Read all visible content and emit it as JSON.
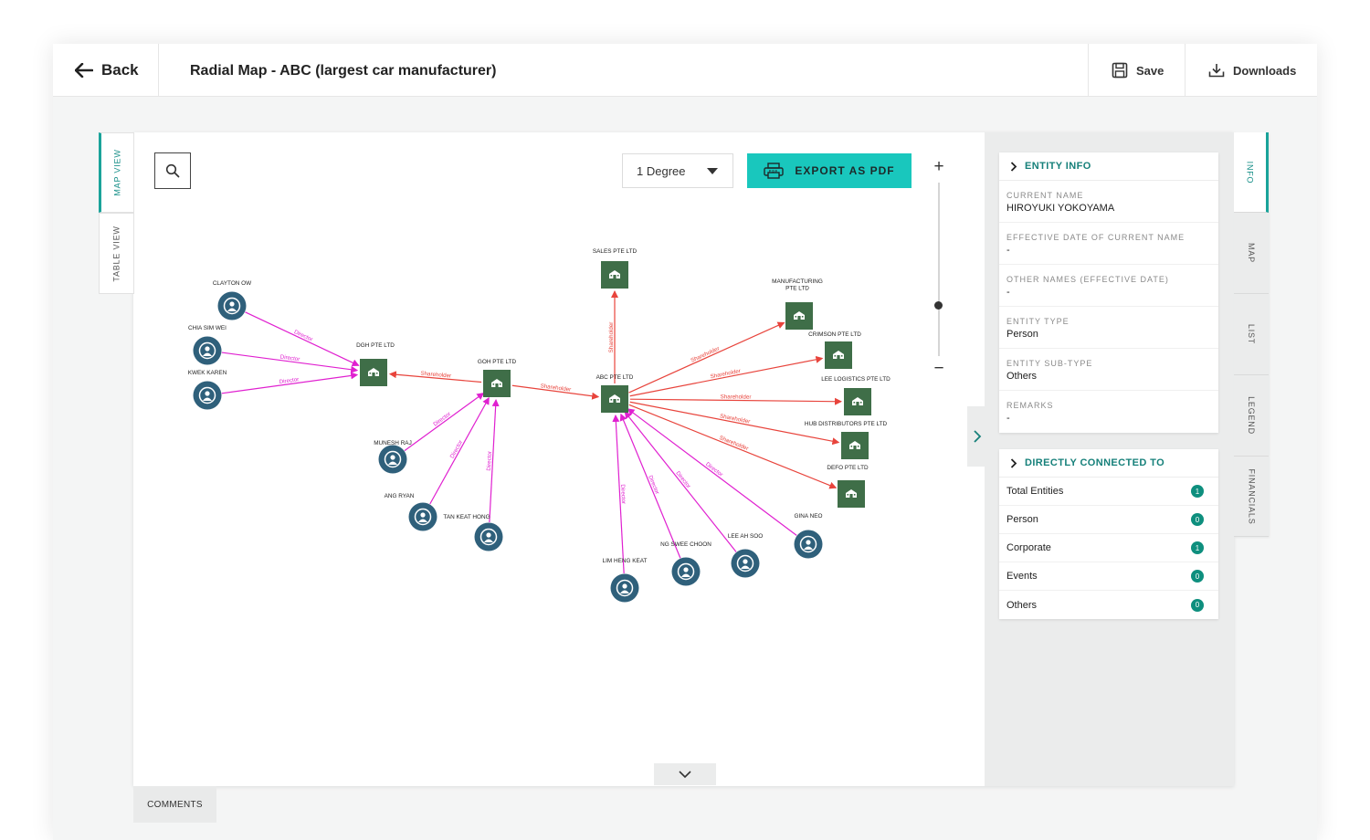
{
  "header": {
    "back_label": "Back",
    "title": "Radial Map - ABC (largest car manufacturer)",
    "save_label": "Save",
    "downloads_label": "Downloads"
  },
  "left_tabs": [
    {
      "label": "MAP VIEW",
      "active": true
    },
    {
      "label": "TABLE VIEW",
      "active": false
    }
  ],
  "toolbar": {
    "degree_selected": "1 Degree",
    "export_label": "EXPORT AS PDF"
  },
  "graph": {
    "nodes": [
      {
        "id": "clayton",
        "label": "CLAYTON OW",
        "type": "person"
      },
      {
        "id": "chia",
        "label": "CHIA SIM WEI",
        "type": "person"
      },
      {
        "id": "kwek",
        "label": "KWEK KAREN",
        "type": "person"
      },
      {
        "id": "dgh",
        "label": "DGH PTE LTD",
        "type": "company"
      },
      {
        "id": "goh",
        "label": "GOH PTE LTD",
        "type": "company"
      },
      {
        "id": "munesh",
        "label": "MUNESH RAJ",
        "type": "person"
      },
      {
        "id": "ang",
        "label": "ANG RYAN",
        "type": "person"
      },
      {
        "id": "tan",
        "label": "TAN KEAT HONG",
        "type": "person"
      },
      {
        "id": "abc",
        "label": "ABC PTE LTD",
        "type": "company"
      },
      {
        "id": "sales",
        "label": "SALES PTE LTD",
        "type": "company"
      },
      {
        "id": "manu",
        "label": "MANUFACTURING PTE LTD",
        "type": "company"
      },
      {
        "id": "crimson",
        "label": "CRIMSON PTE LTD",
        "type": "company"
      },
      {
        "id": "leelog",
        "label": "LEE LOGISTICS PTE LTD",
        "type": "company"
      },
      {
        "id": "hub",
        "label": "HUB DISTRIBUTORS PTE LTD",
        "type": "company"
      },
      {
        "id": "defo",
        "label": "DEFO PTE LTD",
        "type": "company"
      },
      {
        "id": "gina",
        "label": "GINA NEO",
        "type": "person"
      },
      {
        "id": "leeah",
        "label": "LEE AH SOO",
        "type": "person"
      },
      {
        "id": "ngswee",
        "label": "NG SWEE CHOON",
        "type": "person"
      },
      {
        "id": "limheng",
        "label": "LIM HENG KEAT",
        "type": "person"
      }
    ],
    "edges": [
      {
        "from": "clayton",
        "to": "dgh",
        "label": "Director",
        "kind": "director"
      },
      {
        "from": "chia",
        "to": "dgh",
        "label": "Director",
        "kind": "director"
      },
      {
        "from": "kwek",
        "to": "dgh",
        "label": "Director",
        "kind": "director"
      },
      {
        "from": "goh",
        "to": "dgh",
        "label": "Shareholder",
        "kind": "shareholder"
      },
      {
        "from": "munesh",
        "to": "goh",
        "label": "Director",
        "kind": "director"
      },
      {
        "from": "ang",
        "to": "goh",
        "label": "Director",
        "kind": "director"
      },
      {
        "from": "tan",
        "to": "goh",
        "label": "Director",
        "kind": "director"
      },
      {
        "from": "goh",
        "to": "abc",
        "label": "Shareholder",
        "kind": "shareholder"
      },
      {
        "from": "abc",
        "to": "sales",
        "label": "Shareholder",
        "kind": "shareholder"
      },
      {
        "from": "abc",
        "to": "manu",
        "label": "Shareholder",
        "kind": "shareholder"
      },
      {
        "from": "abc",
        "to": "crimson",
        "label": "Shareholder",
        "kind": "shareholder"
      },
      {
        "from": "abc",
        "to": "leelog",
        "label": "Shareholder",
        "kind": "shareholder"
      },
      {
        "from": "abc",
        "to": "hub",
        "label": "Shareholder",
        "kind": "shareholder"
      },
      {
        "from": "abc",
        "to": "defo",
        "label": "Shareholder",
        "kind": "shareholder"
      },
      {
        "from": "gina",
        "to": "abc",
        "label": "Director",
        "kind": "director"
      },
      {
        "from": "leeah",
        "to": "abc",
        "label": "Director",
        "kind": "director"
      },
      {
        "from": "ngswee",
        "to": "abc",
        "label": "Director",
        "kind": "director"
      },
      {
        "from": "limheng",
        "to": "abc",
        "label": "Director",
        "kind": "director"
      }
    ]
  },
  "entity_info": {
    "heading": "ENTITY INFO",
    "fields": [
      {
        "label": "CURRENT NAME",
        "value": "HIROYUKI YOKOYAMA"
      },
      {
        "label": "EFFECTIVE DATE OF CURRENT NAME",
        "value": "-"
      },
      {
        "label": "OTHER NAMES (EFFECTIVE DATE)",
        "value": "-"
      },
      {
        "label": "ENTITY TYPE",
        "value": "Person"
      },
      {
        "label": "ENTITY SUB-TYPE",
        "value": "Others"
      },
      {
        "label": "REMARKS",
        "value": "-"
      }
    ]
  },
  "connected": {
    "heading": "DIRECTLY CONNECTED TO",
    "rows": [
      {
        "label": "Total Entities",
        "count": "1"
      },
      {
        "label": "Person",
        "count": "0"
      },
      {
        "label": "Corporate",
        "count": "1"
      },
      {
        "label": "Events",
        "count": "0"
      },
      {
        "label": "Others",
        "count": "0"
      }
    ]
  },
  "right_tabs": [
    {
      "label": "INFO",
      "active": true
    },
    {
      "label": "MAP",
      "active": false
    },
    {
      "label": "LIST",
      "active": false
    },
    {
      "label": "LEGEND",
      "active": false
    },
    {
      "label": "FINANCIALS",
      "active": false
    }
  ],
  "comments_label": "COMMENTS",
  "colors": {
    "accent": "#19c7bd",
    "teal_text": "#16807a",
    "company_node": "#3f6e48",
    "person_node": "#2f607b",
    "director_edge": "#e020d0",
    "shareholder_edge": "#e8443c"
  }
}
